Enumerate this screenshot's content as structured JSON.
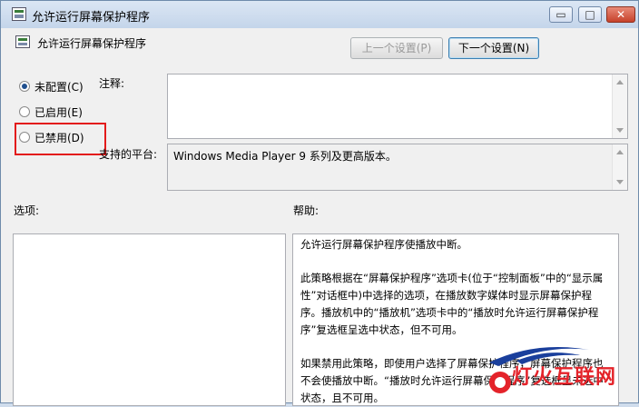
{
  "window": {
    "title": "允许运行屏幕保护程序",
    "controls": {
      "minimize": "▭",
      "maximize": "□",
      "close": "✕"
    }
  },
  "header": {
    "title": "允许运行屏幕保护程序",
    "prev_button": "上一个设置(P)",
    "next_button": "下一个设置(N)"
  },
  "state": {
    "options": [
      {
        "label": "未配置(C)",
        "selected": true
      },
      {
        "label": "已启用(E)",
        "selected": false
      },
      {
        "label": "已禁用(D)",
        "selected": false
      }
    ]
  },
  "comment": {
    "label": "注释:",
    "value": ""
  },
  "platform": {
    "label": "支持的平台:",
    "value": "Windows Media Player 9 系列及更高版本。"
  },
  "options_section": {
    "label": "选项:"
  },
  "help_section": {
    "label": "帮助:",
    "paragraphs": [
      "允许运行屏幕保护程序使播放中断。",
      "此策略根据在“屏幕保护程序”选项卡(位于“控制面板”中的“显示属性”对话框中)中选择的选项，在播放数字媒体时显示屏幕保护程序。播放机中的“播放机”选项卡中的“播放时允许运行屏幕保护程序”复选框呈选中状态，但不可用。",
      "如果禁用此策略，即使用户选择了屏幕保护程序，屏幕保护程序也不会使播放中断。“播放时允许运行屏幕保护程序”复选框呈未选中状态，且不可用。"
    ]
  },
  "watermark": {
    "text": "灯火互联网"
  },
  "colors": {
    "highlight": "#e31b1b",
    "watermark": "#e4232a",
    "logo_blue": "#1a3f9c"
  }
}
